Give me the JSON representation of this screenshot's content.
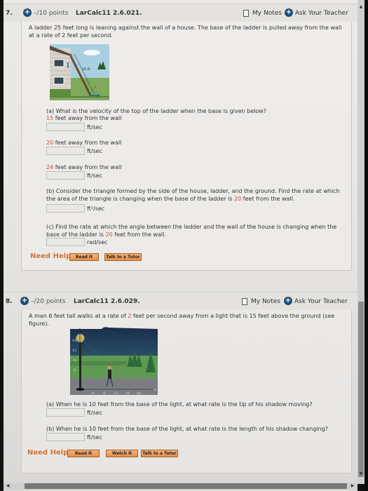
{
  "questions": [
    {
      "number": "7.",
      "points": "–/10 points",
      "id": "LarCalc11 2.6.021.",
      "my_notes": "My Notes",
      "ask_teacher": "Ask Your Teacher",
      "stem": "A ladder 25 feet long is leaning against the wall of a house. The base of the ladder is pulled away from the wall at a rate of 2 feet per second.",
      "figure": {
        "icon": "ladder-house-figure",
        "ladder_label": "25 ft",
        "rate_label": "2 ft/sec",
        "r_label": "r"
      },
      "parts": [
        {
          "prompt": "(a) What is the velocity of the top of the ladder when the base is given below?"
        },
        {
          "highlight": "15",
          "text": " feet away from the wall",
          "value": "",
          "unit": "ft/sec"
        },
        {
          "highlight": "20",
          "text": " feet away from the wall",
          "value": "",
          "unit": "ft/sec"
        },
        {
          "highlight": "24",
          "text": " feet away from the wall",
          "value": "",
          "unit": "ft/sec"
        },
        {
          "prompt_a": "(b) Consider the triangle formed by the side of the house, ladder, and the ground. Find the rate at which the area of the triangle is changing when the base of the ladder is ",
          "highlight": "20",
          "prompt_b": " feet from the wall.",
          "value": "",
          "unit": "ft²/sec"
        },
        {
          "prompt_a": "(c) Find the rate at which the angle between the ladder and the wall of the house is changing when the base of the ladder is ",
          "highlight": "20",
          "prompt_b": " feet from the wall.",
          "value": "",
          "unit": "rad/sec"
        }
      ],
      "need_help": "Need Help?",
      "help_buttons": [
        "Read It",
        "Talk to a Tutor"
      ]
    },
    {
      "number": "8.",
      "points": "–/20 points",
      "id": "LarCalc11 2.6.029.",
      "my_notes": "My Notes",
      "ask_teacher": "Ask Your Teacher",
      "stem_a": "A man 6 feet tall walks at a rate of ",
      "stem_highlight": "2",
      "stem_b": " feet per second away from a light that is 15 feet above the ground (see figure).",
      "figure": {
        "icon": "lamp-post-figure",
        "y_label": "y",
        "x_label": "x",
        "y_ticks": [
          "16",
          "12",
          "8",
          "4"
        ],
        "x_ticks": [
          "4",
          "8",
          "12",
          "16",
          "20"
        ]
      },
      "parts": [
        {
          "prompt": "(a) When he is 10 feet from the base of the light, at what rate is the tip of his shadow moving?",
          "value": "",
          "unit": "ft/sec"
        },
        {
          "prompt": "(b) When he is 10 feet from the base of the light, at what rate is the length of his shadow changing?",
          "value": "",
          "unit": "ft/sec"
        }
      ],
      "need_help": "Need Help?",
      "help_buttons": [
        "Read It",
        "Watch It",
        "Talk to a Tutor"
      ]
    }
  ],
  "colors": {
    "highlight_red": "#c0504d",
    "help_orange": "#d0753a",
    "plus_blue": "#1f4e79"
  }
}
